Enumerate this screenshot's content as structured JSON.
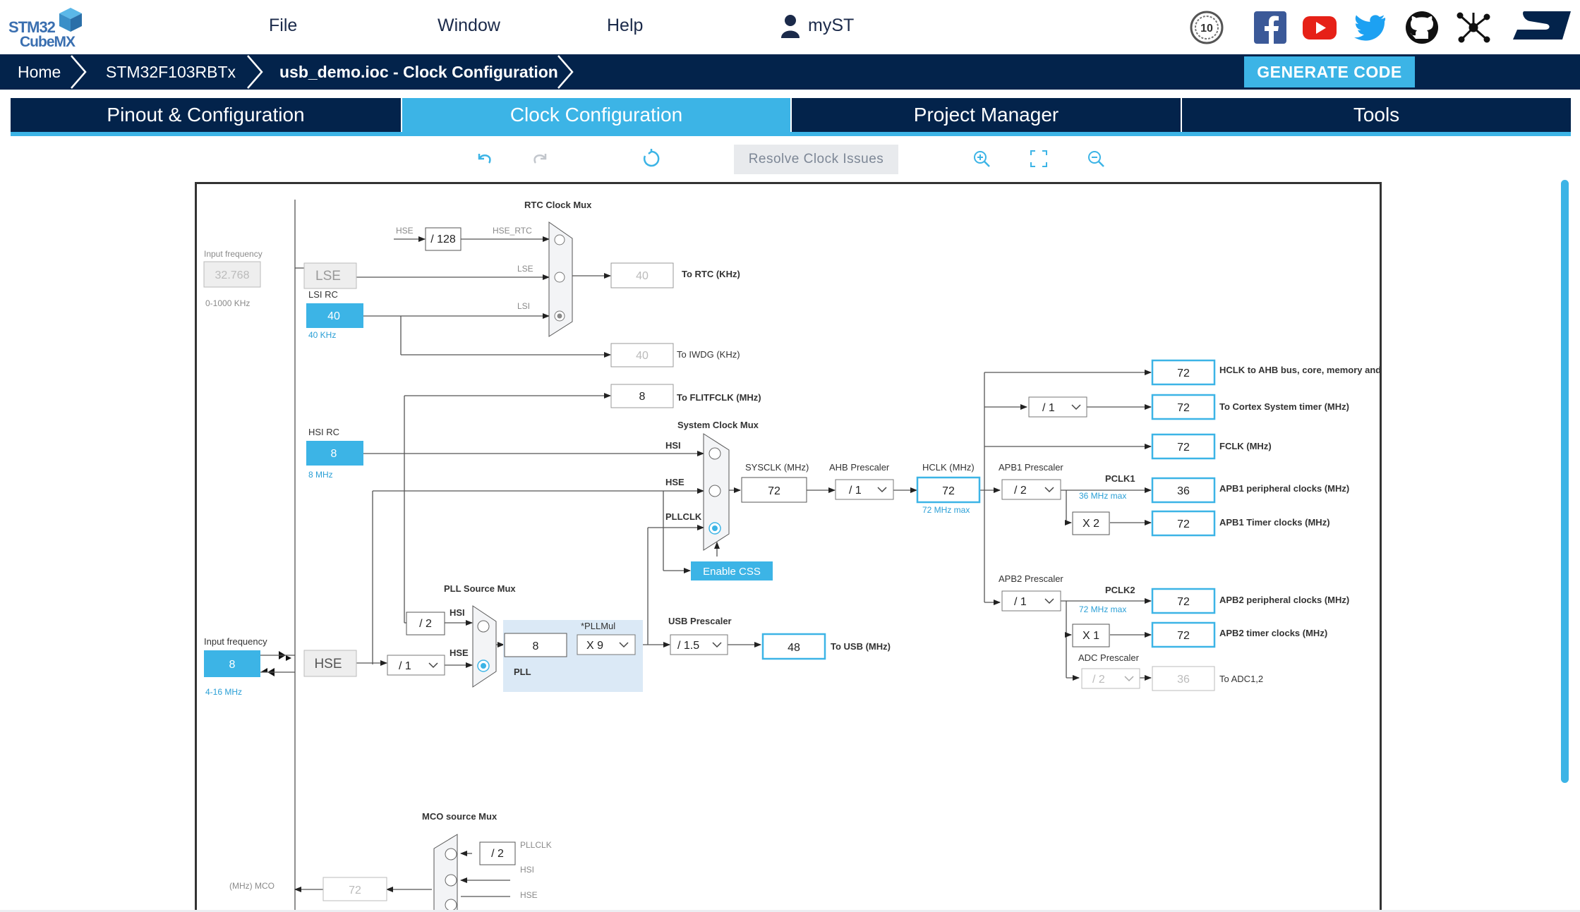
{
  "header": {
    "logo_line1": "STM32",
    "logo_line2": "CubeMX",
    "menu": [
      "File",
      "Window",
      "Help"
    ],
    "user_label": "myST",
    "social_icons": [
      "anniversary-10-icon",
      "facebook-icon",
      "youtube-icon",
      "twitter-icon",
      "github-icon",
      "network-icon",
      "st-logo-icon"
    ]
  },
  "breadcrumb": {
    "items": [
      "Home",
      "STM32F103RBTx",
      "usb_demo.ioc - Clock Configuration"
    ],
    "generate_label": "GENERATE CODE"
  },
  "tabs": [
    "Pinout & Configuration",
    "Clock Configuration",
    "Project Manager",
    "Tools"
  ],
  "active_tab": "Clock Configuration",
  "toolbar": {
    "resolve_label": "Resolve Clock Issues",
    "icons": [
      "undo-icon",
      "redo-icon",
      "reset-icon",
      "zoom-in-icon",
      "fit-icon",
      "zoom-out-icon"
    ]
  },
  "colors": {
    "navy": "#03234b",
    "accent": "#3cb4e6",
    "pll_bg": "#dbe9f6"
  },
  "diagram": {
    "rtc_mux_title": "RTC Clock Mux",
    "lse_input_label": "Input frequency",
    "lse_input_value": "32.768",
    "lse_range": "0-1000 KHz",
    "lse_label": "LSE",
    "lsi_rc_label": "LSI RC",
    "lsi_value": "40",
    "lsi_freq": "40 KHz",
    "hse_label_small": "HSE",
    "div128": "/ 128",
    "hse_rtc": "HSE_RTC",
    "lse_small": "LSE",
    "lsi_small": "LSI",
    "rtc_value": "40",
    "rtc_label": "To RTC (KHz)",
    "iwdg_value": "40",
    "iwdg_label": "To IWDG (KHz)",
    "flit_value": "8",
    "flit_label": "To FLITFCLK (MHz)",
    "hsi_rc_label": "HSI RC",
    "hsi_value": "8",
    "hsi_freq": "8 MHz",
    "sysmux_title": "System Clock Mux",
    "hsi_small": "HSI",
    "hse_small2": "HSE",
    "pllclk_small": "PLLCLK",
    "sysclk_label": "SYSCLK (MHz)",
    "sysclk_value": "72",
    "ahb_label": "AHB Prescaler",
    "ahb_value": "/ 1",
    "hclk_label": "HCLK (MHz)",
    "hclk_value": "72",
    "hclk_max": "72 MHz max",
    "enable_css": "Enable CSS",
    "hse_input_label": "Input frequency",
    "hse_value": "8",
    "hse_range": "4-16 MHz",
    "hse_label": "HSE",
    "hse_div": "/ 1",
    "pll_src_title": "PLL Source Mux",
    "pll_div2": "/ 2",
    "pll_hsi": "HSI",
    "pll_hse": "HSE",
    "pll_in": "8",
    "pllmul_label": "*PLLMul",
    "pllmul_value": "X 9",
    "pll_label": "PLL",
    "usb_pre_label": "USB Prescaler",
    "usb_pre_value": "/ 1.5",
    "usb_value": "48",
    "usb_label": "To USB (MHz)",
    "apb1_pre_label": "APB1 Prescaler",
    "apb1_pre_value": "/ 2",
    "pclk1_label": "PCLK1",
    "pclk1_max": "36 MHz max",
    "apb1_x": "X 2",
    "cortex_div": "/ 1",
    "apb2_pre_label": "APB2 Prescaler",
    "apb2_pre_value": "/ 1",
    "pclk2_label": "PCLK2",
    "pclk2_max": "72 MHz max",
    "apb2_x": "X 1",
    "adc_pre_label": "ADC Prescaler",
    "adc_pre_value": "/ 2",
    "outputs": [
      {
        "value": "72",
        "label": "HCLK to AHB bus, core, memory and DMA (MHz)"
      },
      {
        "value": "72",
        "label": "To Cortex System timer (MHz)"
      },
      {
        "value": "72",
        "label": "FCLK (MHz)"
      },
      {
        "value": "36",
        "label": "APB1 peripheral clocks (MHz)"
      },
      {
        "value": "72",
        "label": "APB1 Timer clocks (MHz)"
      },
      {
        "value": "72",
        "label": "APB2 peripheral clocks (MHz)"
      },
      {
        "value": "72",
        "label": "APB2 timer clocks (MHz)"
      },
      {
        "value": "36",
        "label": "To ADC1,2"
      }
    ],
    "mco_title": "MCO source Mux",
    "mco_label": "(MHz) MCO",
    "mco_value": "72",
    "mco_div": "/ 2",
    "mco_pllclk": "PLLCLK",
    "mco_hsi": "HSI",
    "mco_hse": "HSE"
  }
}
